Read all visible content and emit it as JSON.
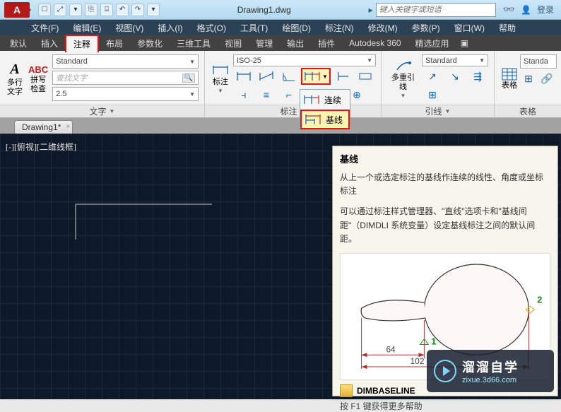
{
  "titlebar": {
    "app": "A",
    "document": "Drawing1.dwg",
    "search_placeholder": "键入关键字或短语",
    "login": "登录"
  },
  "menus": [
    "文件(F)",
    "编辑(E)",
    "视图(V)",
    "插入(I)",
    "格式(O)",
    "工具(T)",
    "绘图(D)",
    "标注(N)",
    "修改(M)",
    "参数(P)",
    "窗口(W)",
    "帮助"
  ],
  "tabs": [
    "默认",
    "插入",
    "注释",
    "布局",
    "参数化",
    "三维工具",
    "视图",
    "管理",
    "输出",
    "插件",
    "Autodesk 360",
    "精选应用"
  ],
  "active_tab": "注释",
  "ribbon": {
    "text_panel": {
      "btn_multitext": "多行\n文字",
      "btn_check": "拼写\n检查",
      "check_icon": "ABC",
      "style_combo": "Standard",
      "search_placeholder": "查找文字",
      "height_combo": "2.5",
      "title": "文字"
    },
    "dim_panel": {
      "title": "标注",
      "style_combo": "ISO-25",
      "btn_label": "标注"
    },
    "leader_panel": {
      "title": "引线",
      "style_combo": "Standard",
      "btn_label": "多重引线"
    },
    "table_panel": {
      "title": "表格",
      "style_combo": "Standa",
      "btn_label": "表格"
    }
  },
  "flyout": {
    "items": [
      "连续",
      "基线"
    ]
  },
  "doctab": "Drawing1*",
  "view_label": "[-][俯视][二维线框]",
  "tooltip": {
    "title": "基线",
    "desc1": "从上一个或选定标注的基线作连续的线性、角度或坐标标注",
    "desc2": "可以通过标注样式管理器、\"直线\"选项卡和\"基线间距\"（DIMDLI 系统变量）设定基线标注之间的默认间距。",
    "cmd": "DIMBASELINE",
    "f1": "按 F1 键获得更多帮助",
    "illus": {
      "d64": "64",
      "d102": "102",
      "pt1": "1",
      "pt2": "2"
    }
  },
  "watermark": {
    "big": "溜溜自学",
    "url": "zixue.3d66.com"
  }
}
